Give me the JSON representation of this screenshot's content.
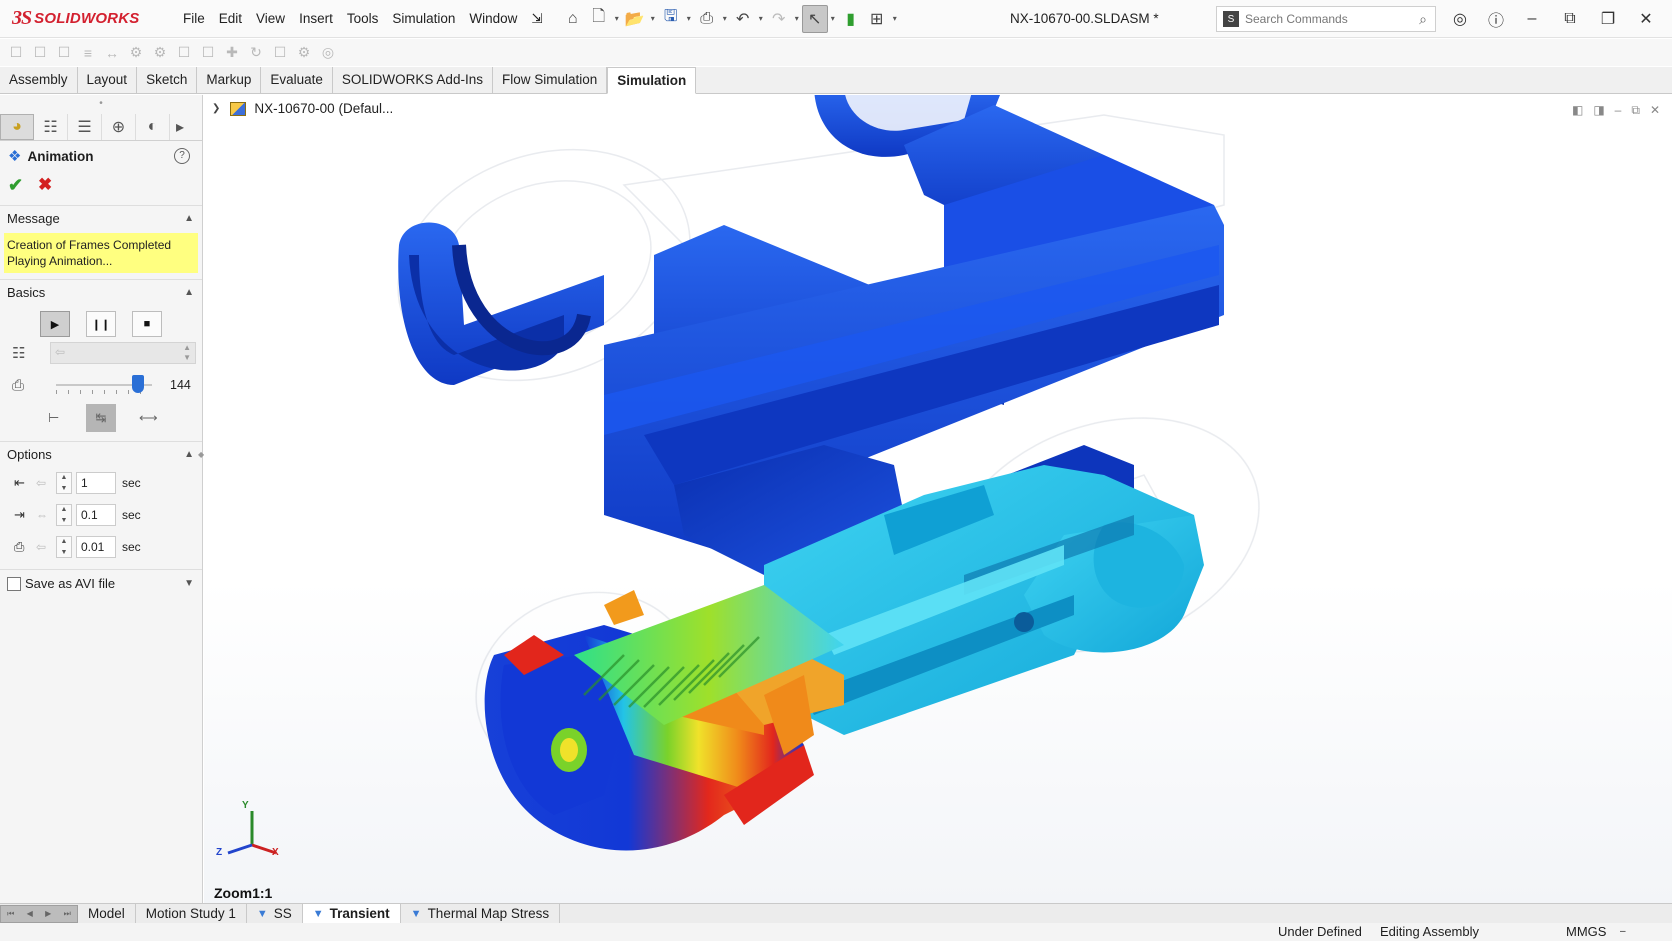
{
  "app": {
    "logo_mark": "3S",
    "logo_text": "SOLIDWORKS",
    "menu": [
      "File",
      "Edit",
      "View",
      "Insert",
      "Tools",
      "Simulation",
      "Window"
    ],
    "document_title": "NX-10670-00.SLDASM *",
    "search_placeholder": "Search Commands",
    "search_badge": "S"
  },
  "command_tabs": [
    {
      "label": "Assembly",
      "active": false
    },
    {
      "label": "Layout",
      "active": false
    },
    {
      "label": "Sketch",
      "active": false
    },
    {
      "label": "Markup",
      "active": false
    },
    {
      "label": "Evaluate",
      "active": false
    },
    {
      "label": "SOLIDWORKS Add-Ins",
      "active": false
    },
    {
      "label": "Flow Simulation",
      "active": false
    },
    {
      "label": "Simulation",
      "active": true
    }
  ],
  "property_manager": {
    "title": "Animation",
    "help": "?",
    "ok_icon": "check-icon",
    "cancel_icon": "x-icon",
    "message": {
      "heading": "Message",
      "line1": "Creation of Frames Completed",
      "line2": "Playing Animation..."
    },
    "basics": {
      "heading": "Basics",
      "slider_value": "144",
      "slider_fraction": 0.85
    },
    "options": {
      "heading": "Options",
      "rows": [
        {
          "value": "1",
          "unit": "sec"
        },
        {
          "value": "0.1",
          "unit": "sec"
        },
        {
          "value": "0.01",
          "unit": "sec"
        }
      ]
    },
    "save_avi": {
      "label": "Save as AVI file",
      "checked": false
    }
  },
  "viewport": {
    "tree_node": "NX-10670-00 (Defaul...",
    "zoom": "Zoom1:1",
    "axes": {
      "y": "Y",
      "z": "Z",
      "x": "X"
    },
    "thermal_colors": [
      "#1238d6",
      "#23c4e6",
      "#7ad22a",
      "#f0e22a",
      "#f08a1a",
      "#e2261c"
    ]
  },
  "bottom_tabs": [
    {
      "label": "Model",
      "active": false,
      "icon": ""
    },
    {
      "label": "Motion Study 1",
      "active": false,
      "icon": ""
    },
    {
      "label": "SS",
      "active": false,
      "icon": "study-icon"
    },
    {
      "label": "Transient",
      "active": true,
      "icon": "study-icon"
    },
    {
      "label": "Thermal Map Stress",
      "active": false,
      "icon": "study-icon"
    }
  ],
  "status": {
    "under_defined": "Under Defined",
    "editing": "Editing Assembly",
    "units": "MMGS"
  }
}
